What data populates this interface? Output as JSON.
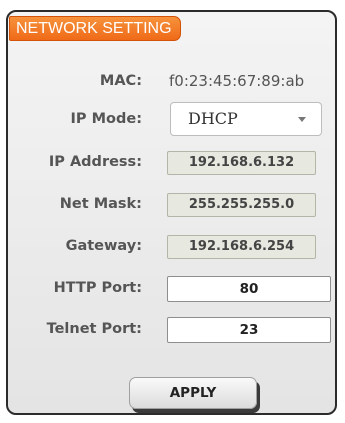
{
  "panel": {
    "title": "NETWORK SETTING"
  },
  "fields": {
    "mac": {
      "label": "MAC:",
      "value": "f0:23:45:67:89:ab"
    },
    "ip_mode": {
      "label": "IP Mode:",
      "value": "DHCP"
    },
    "ip_address": {
      "label": "IP Address:",
      "value": "192.168.6.132"
    },
    "net_mask": {
      "label": "Net Mask:",
      "value": "255.255.255.0"
    },
    "gateway": {
      "label": "Gateway:",
      "value": "192.168.6.254"
    },
    "http_port": {
      "label": "HTTP Port:",
      "value": "80"
    },
    "telnet_port": {
      "label": "Telnet Port:",
      "value": "23"
    }
  },
  "actions": {
    "apply_label": "APPLY"
  },
  "icons": {
    "ip_mode_dropdown": "chevron-down-icon"
  },
  "colors": {
    "title_tab": "#ef6a18",
    "panel_border": "#2b2b2b",
    "readonly_field": "#e7e8e0"
  }
}
